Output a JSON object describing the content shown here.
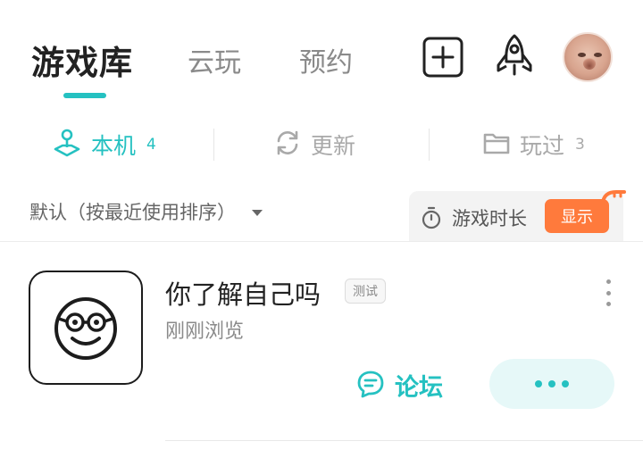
{
  "colors": {
    "accent": "#25c1c1",
    "muted": "#a9a9a9",
    "orange": "#ff7a3c",
    "more_btn_bg": "#e6f8f8"
  },
  "header": {
    "tabs": [
      {
        "label": "游戏库",
        "active": true
      },
      {
        "label": "云玩",
        "active": false
      },
      {
        "label": "预约",
        "active": false
      }
    ],
    "icons": [
      "add-square-icon",
      "rocket-icon",
      "avatar"
    ]
  },
  "filters": [
    {
      "label": "本机",
      "count": "4",
      "icon": "joystick-icon",
      "active": true
    },
    {
      "label": "更新",
      "count": "",
      "icon": "refresh-icon",
      "active": false
    },
    {
      "label": "玩过",
      "count": "3",
      "icon": "folder-icon",
      "active": false
    }
  ],
  "sort": {
    "label": "默认（按最近使用排序）",
    "icon": "caret-down-icon"
  },
  "play_time": {
    "label": "游戏时长",
    "toggle_label": "显示",
    "icon": "timer-icon"
  },
  "game": {
    "title": "你了解自己吗",
    "tag": "测试",
    "subtitle": "刚刚浏览",
    "forum_label": "论坛",
    "icon": "smiley-glasses-icon"
  }
}
